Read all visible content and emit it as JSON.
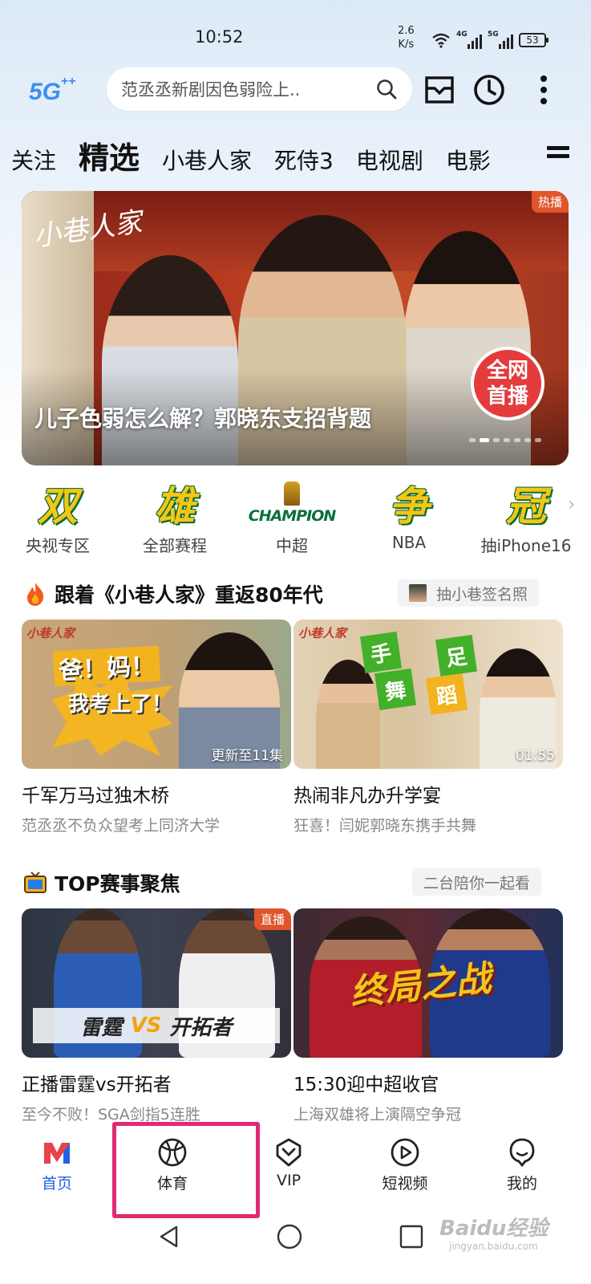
{
  "status_bar": {
    "time": "10:52",
    "net_speed_value": "2.6",
    "net_speed_unit": "K/s",
    "net1": "4G",
    "net2": "5G",
    "battery": "53"
  },
  "header": {
    "logo_text": "5G",
    "search_placeholder": "范丞丞新剧因色弱险上..",
    "icons": [
      "search-icon",
      "inbox-icon",
      "history-clock-icon",
      "more-vertical-icon"
    ]
  },
  "tabs": [
    "关注",
    "精选",
    "小巷人家",
    "死侍3",
    "电视剧",
    "电影"
  ],
  "active_tab": "精选",
  "banner": {
    "logo": "小巷人家",
    "badge": "热播",
    "live_badge_line1": "全网",
    "live_badge_line2": "首播",
    "title": "儿子色弱怎么解？郭晓东支招背题",
    "slide_count": 7,
    "active_slide": 1
  },
  "quick_icons": [
    {
      "glyph": "双",
      "label": "央视专区"
    },
    {
      "glyph": "雄",
      "label": "全部赛程"
    },
    {
      "glyph": "CHAMPION",
      "label": "中超"
    },
    {
      "glyph": "争",
      "label": "NBA"
    },
    {
      "glyph": "冠",
      "label": "抽iPhone16"
    }
  ],
  "section1": {
    "title": "跟着《小巷人家》重返80年代",
    "pill": "抽小巷签名照",
    "cards": [
      {
        "corner": "小巷人家",
        "overlay1": "爸！妈！",
        "overlay2": "我考上了！",
        "tag": "更新至11集",
        "title": "千军万马过独木桥",
        "sub": "范丞丞不负众望考上同济大学"
      },
      {
        "corner": "小巷人家",
        "dance": [
          "手",
          "舞",
          "足",
          "蹈"
        ],
        "tag": "01:55",
        "title": "热闹非凡办升学宴",
        "sub": "狂喜！闫妮郭晓东携手共舞"
      }
    ]
  },
  "section2": {
    "title": "TOP赛事聚焦",
    "pill": "二台陪你一起看",
    "cards": [
      {
        "badge": "直播",
        "team1": "雷霆",
        "vs": "VS",
        "team2": "开拓者",
        "title": "正播雷霆vs开拓者",
        "sub": "至今不败！SGA剑指5连胜"
      },
      {
        "overlay": "终局之战",
        "title": "15:30迎中超收官",
        "sub": "上海双雄将上演隔空争冠"
      }
    ]
  },
  "bottom_nav": [
    {
      "label": "首页",
      "icon": "home-logo-icon",
      "active": true
    },
    {
      "label": "体育",
      "icon": "basketball-icon",
      "active": false
    },
    {
      "label": "VIP",
      "icon": "vip-diamond-icon",
      "active": false
    },
    {
      "label": "短视频",
      "icon": "play-circle-icon",
      "active": false
    },
    {
      "label": "我的",
      "icon": "profile-icon",
      "active": false
    }
  ],
  "watermark": {
    "text": "Baidu经验",
    "sub": "jingyan.baidu.com"
  },
  "colors": {
    "accent_blue": "#2262e8",
    "highlight_box": "#e02a73",
    "badge_orange": "#e0552c",
    "live_red": "#e43b3d"
  }
}
